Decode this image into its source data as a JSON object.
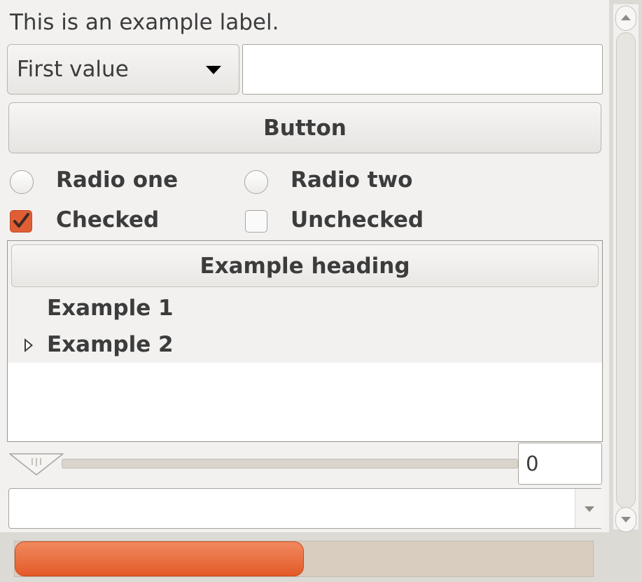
{
  "label": {
    "text": "This is an example label."
  },
  "combo": {
    "selected": "First value"
  },
  "entry": {
    "value": ""
  },
  "button": {
    "label": "Button"
  },
  "radios": [
    {
      "label": "Radio one",
      "selected": false
    },
    {
      "label": "Radio two",
      "selected": false
    }
  ],
  "checks": [
    {
      "label": "Checked",
      "checked": true
    },
    {
      "label": "Unchecked",
      "checked": false
    }
  ],
  "tree": {
    "heading": "Example heading",
    "items": [
      {
        "label": "Example 1",
        "expandable": false
      },
      {
        "label": "Example 2",
        "expandable": true
      }
    ]
  },
  "spin": {
    "value": "0"
  },
  "combo_entry": {
    "value": ""
  },
  "progress": {
    "fraction": 0.5
  },
  "colors": {
    "accent": "#e45a28",
    "background": "#f2f1f0",
    "text": "#3c3c3c"
  }
}
